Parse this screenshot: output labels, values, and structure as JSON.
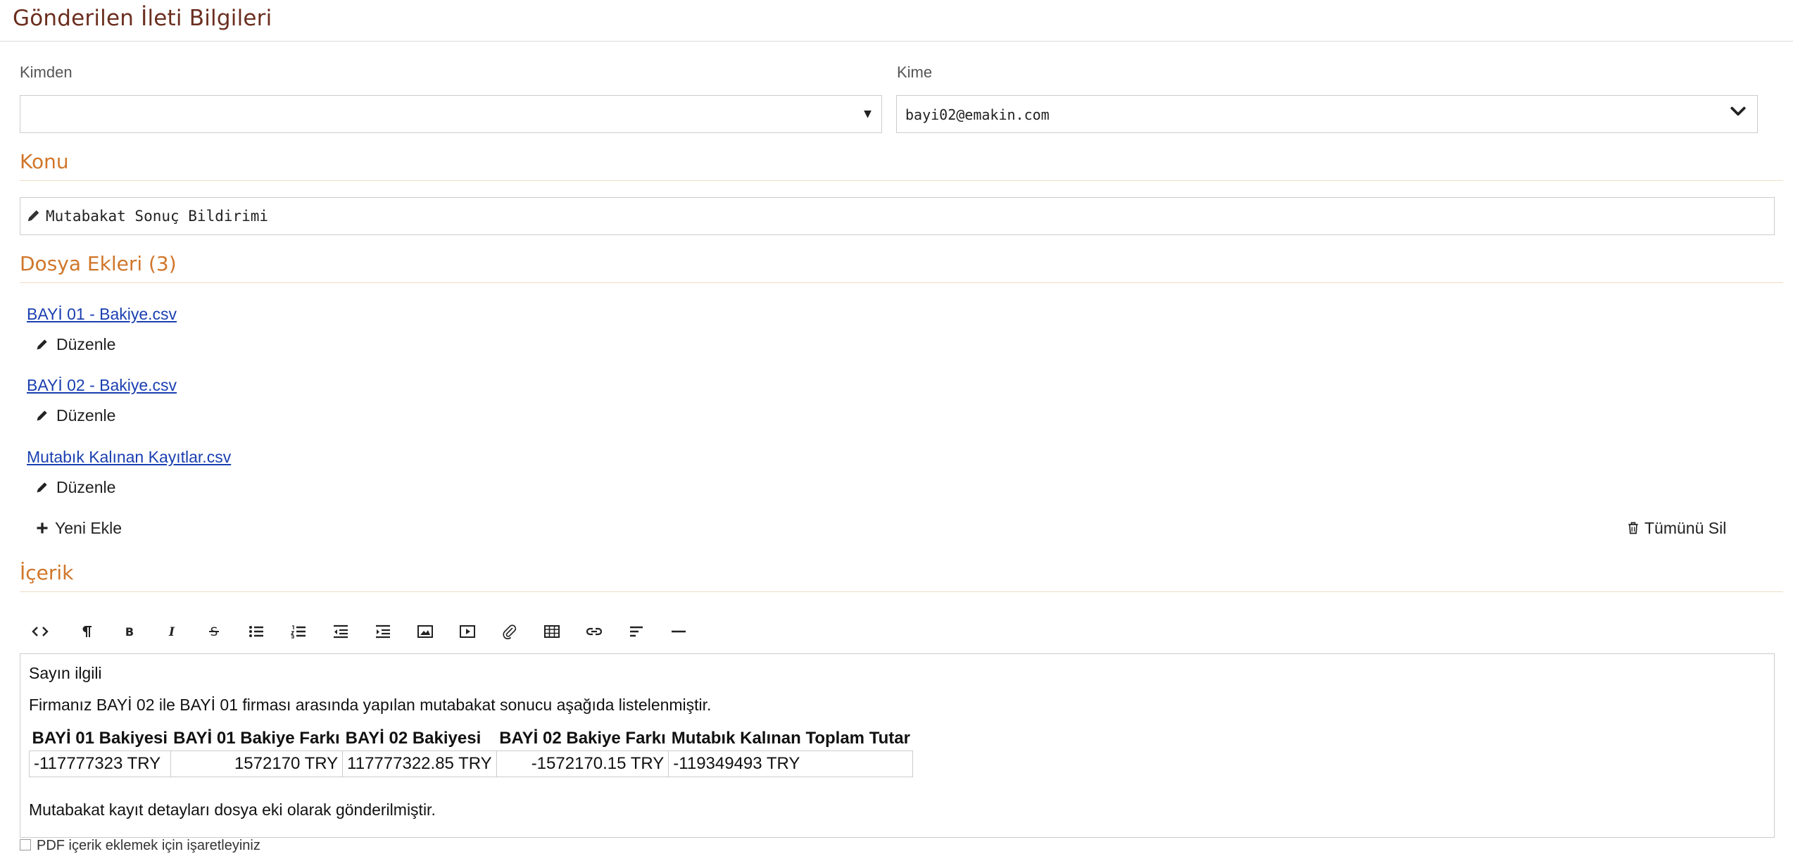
{
  "page": {
    "title": "Gönderilen İleti Bilgileri"
  },
  "from": {
    "label": "Kimden",
    "value": ""
  },
  "to": {
    "label": "Kime",
    "value": "bayi02@emakin.com"
  },
  "subject": {
    "heading": "Konu",
    "value": "Mutabakat Sonuç Bildirimi"
  },
  "attachments": {
    "heading": "Dosya Ekleri (3)",
    "edit_label": "Düzenle",
    "items": [
      {
        "name": "BAYİ 01 - Bakiye.csv"
      },
      {
        "name": "BAYİ 02 - Bakiye.csv"
      },
      {
        "name": "Mutabık Kalınan Kayıtlar.csv"
      }
    ],
    "add_label": "Yeni Ekle",
    "delete_all_label": "Tümünü Sil"
  },
  "content": {
    "heading": "İçerik",
    "toolbar": [
      "code-view-icon",
      "paragraph-icon",
      "bold-icon",
      "italic-icon",
      "strikethrough-icon",
      "unordered-list-icon",
      "ordered-list-icon",
      "outdent-icon",
      "indent-icon",
      "image-icon",
      "video-icon",
      "link-icon",
      "table-icon",
      "hyperlink-icon",
      "align-icon",
      "horizontal-rule-icon"
    ],
    "greeting": "Sayın ilgili",
    "intro": "Firmanız BAYİ 02 ile BAYİ 01 firması arasında yapılan mutabakat sonucu aşağıda listelenmiştir.",
    "table": {
      "headers": [
        "BAYİ 01 Bakiyesi",
        "BAYİ 01 Bakiye Farkı",
        "BAYİ 02 Bakiyesi",
        "BAYİ 02 Bakiye Farkı",
        "Mutabık Kalınan Toplam Tutar"
      ],
      "row": [
        "-117777323 TRY",
        "1572170 TRY",
        "117777322.85 TRY",
        "-1572170.15 TRY",
        "-119349493 TRY"
      ]
    },
    "footer": "Mutabakat kayıt detayları dosya eki olarak gönderilmiştir."
  },
  "pdf_option": {
    "label": "PDF içerik eklemek için işaretleyiniz"
  },
  "colors": {
    "title": "#6b2e1f",
    "section_heading": "#d0762a",
    "link": "#1a3fb0"
  }
}
